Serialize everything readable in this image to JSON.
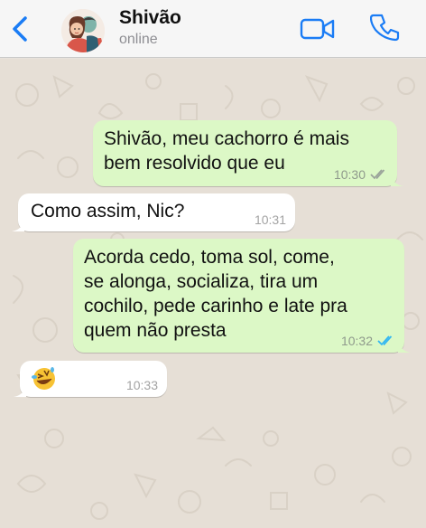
{
  "header": {
    "contact_name": "Shivão",
    "status": "online",
    "back_icon": "chevron-left-icon",
    "video_icon": "video-call-icon",
    "call_icon": "phone-icon",
    "accent_color": "#1a7cf5"
  },
  "messages": [
    {
      "direction": "outgoing",
      "text": "Shivão, meu cachorro é mais\nbem resolvido que eu",
      "time": "10:30",
      "read_state": "delivered"
    },
    {
      "direction": "incoming",
      "text": "Como assim, Nic?",
      "time": "10:31"
    },
    {
      "direction": "outgoing",
      "text": "Acorda cedo, toma sol, come,\nse alonga, socializa, tira um\ncochilo, pede carinho e late pra\nquem não presta",
      "time": "10:32",
      "read_state": "read"
    },
    {
      "direction": "incoming",
      "text": "🤣",
      "time": "10:33"
    }
  ],
  "colors": {
    "outgoing_bubble": "#dcf8c6",
    "incoming_bubble": "#ffffff",
    "read_ticks": "#34b7f1",
    "delivered_ticks": "#9aa39a"
  }
}
